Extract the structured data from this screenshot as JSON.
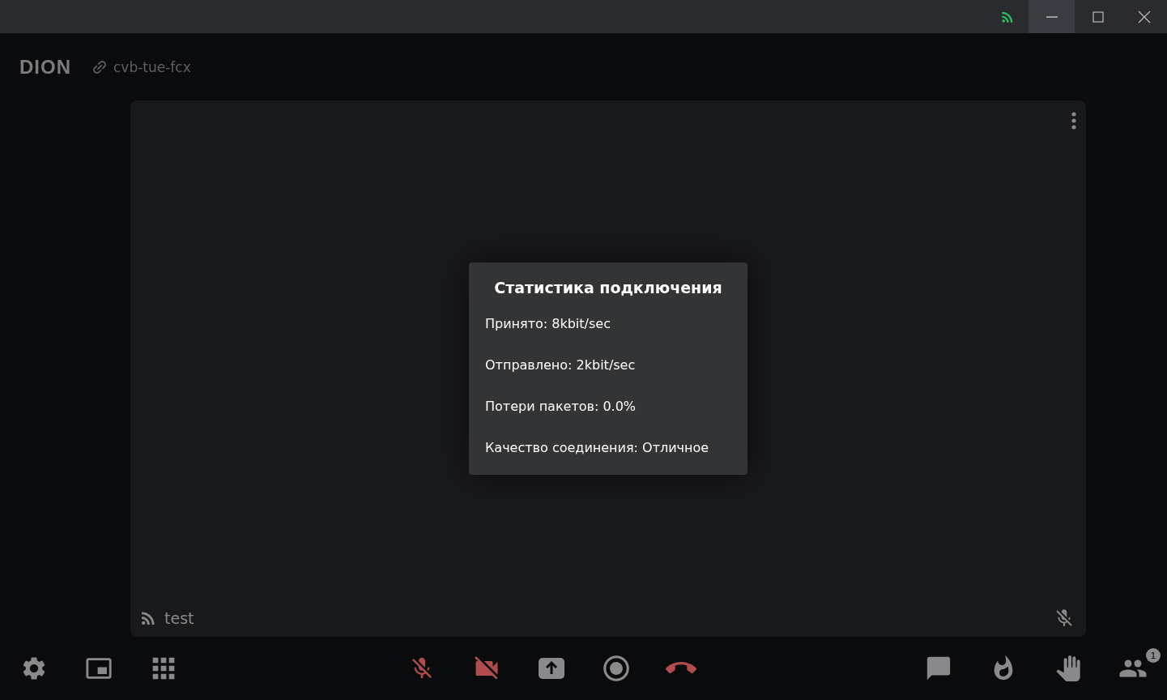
{
  "title_bar": {
    "connection_ok": true
  },
  "header": {
    "logo": "DION",
    "room_code": "cvb-tue-fcx"
  },
  "tile": {
    "name": "test",
    "muted": true
  },
  "stats_dialog": {
    "title": "Статистика подключения",
    "lines": [
      "Принято: 8kbit/sec",
      "Отправлено: 2kbit/sec",
      "Потери пакетов: 0.0%",
      "Качество соединения: Отличное"
    ]
  },
  "toolbar": {
    "left": [
      {
        "kind": "settings"
      },
      {
        "kind": "pip"
      },
      {
        "kind": "grid"
      }
    ],
    "center": [
      {
        "kind": "mic",
        "muted": true
      },
      {
        "kind": "camera",
        "muted": true
      },
      {
        "kind": "share"
      },
      {
        "kind": "record"
      },
      {
        "kind": "hangup"
      }
    ],
    "right": [
      {
        "kind": "chat"
      },
      {
        "kind": "reactions"
      },
      {
        "kind": "hand"
      },
      {
        "kind": "participants",
        "badge": "1"
      }
    ]
  }
}
